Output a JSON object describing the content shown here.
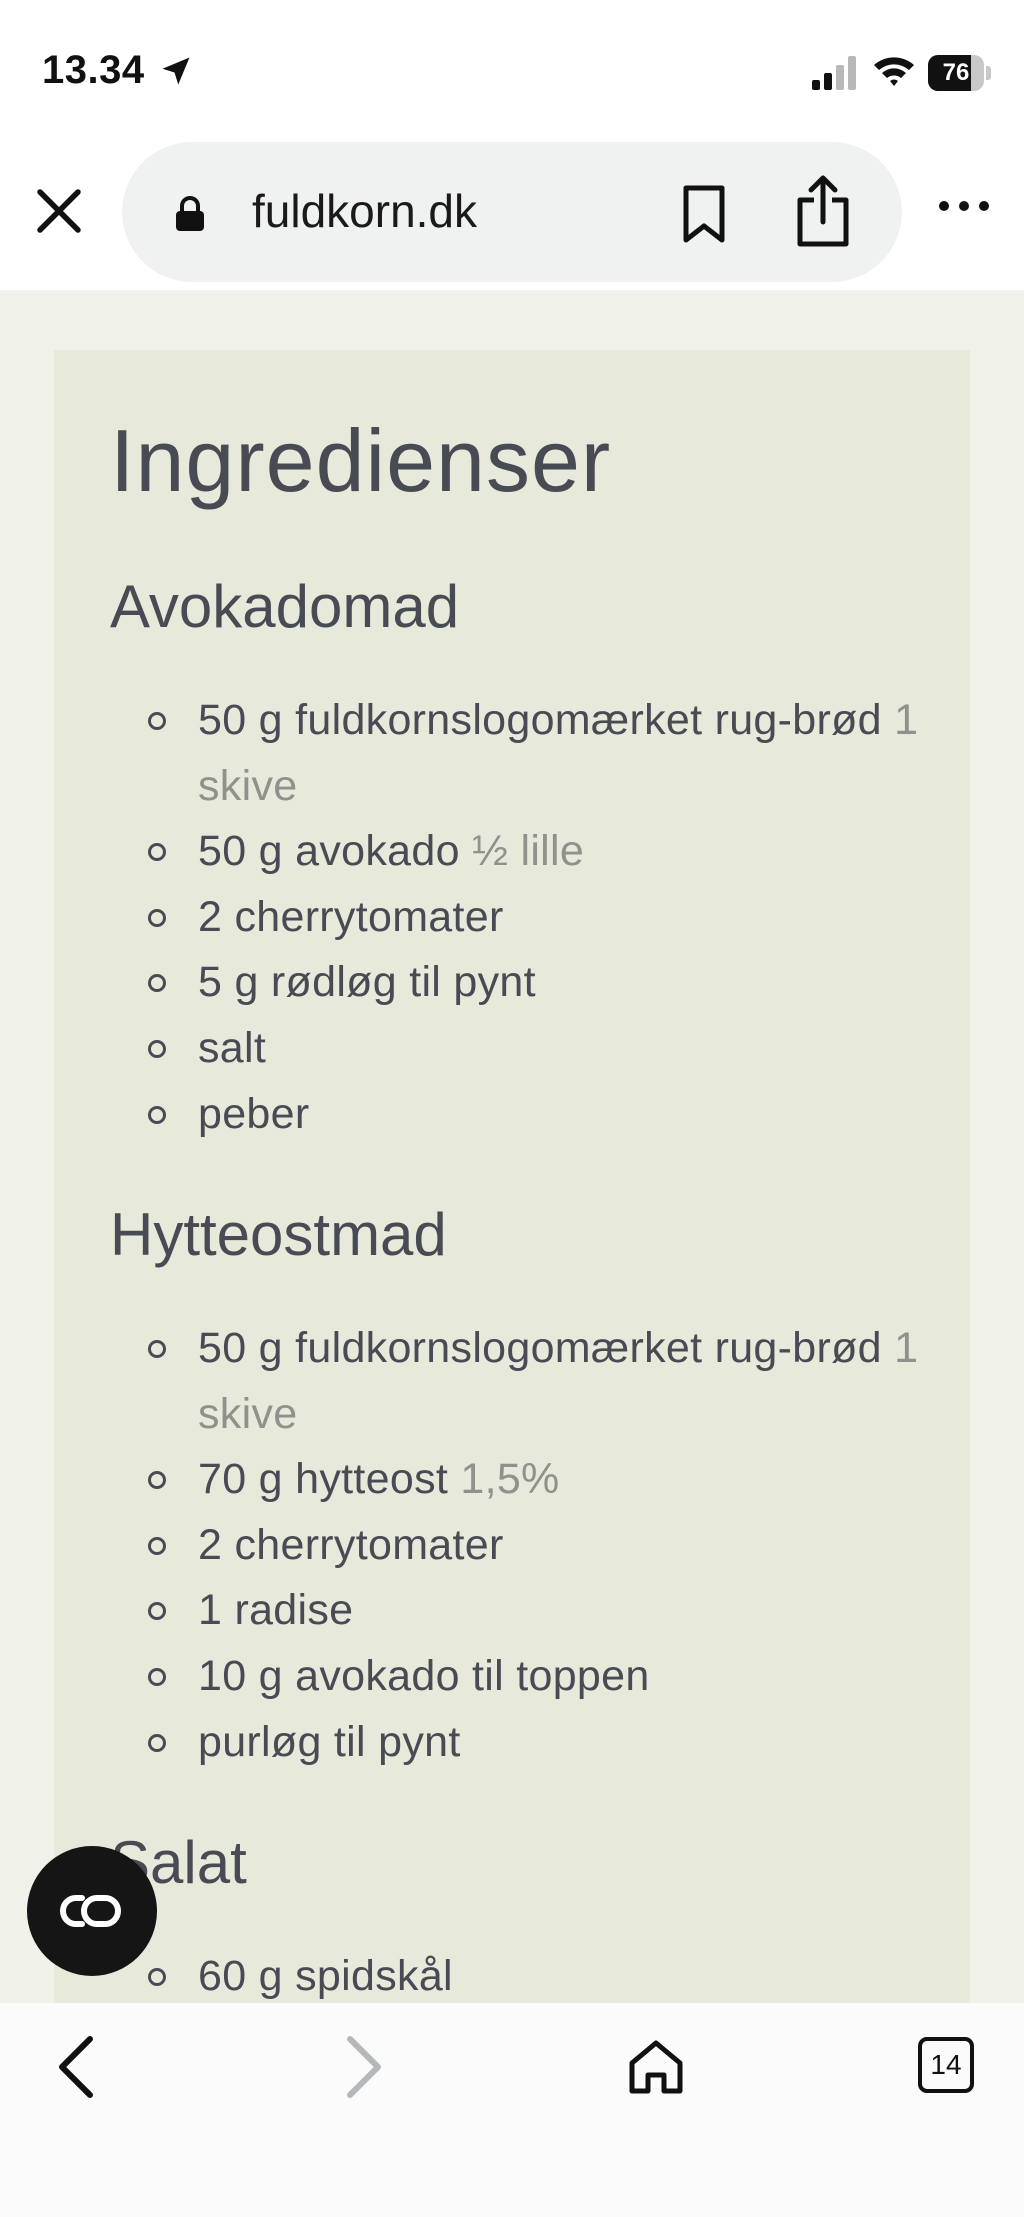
{
  "status": {
    "time": "13.34",
    "battery": "76",
    "battery_level": 0.76
  },
  "browser": {
    "url": "fuldkorn.dk",
    "tab_count": "14"
  },
  "recipe": {
    "title": "Ingredienser",
    "sections": [
      {
        "name": "Avokadomad",
        "items": [
          {
            "text": "50 g fuldkornslogomærket rug-brød",
            "note": "1 skive"
          },
          {
            "text": "50 g avokado",
            "note": "½ lille"
          },
          {
            "text": "2 cherrytomater",
            "note": ""
          },
          {
            "text": "5 g rødløg til pynt",
            "note": ""
          },
          {
            "text": "salt",
            "note": ""
          },
          {
            "text": "peber",
            "note": ""
          }
        ]
      },
      {
        "name": "Hytteostmad",
        "items": [
          {
            "text": "50 g fuldkornslogomærket rug-brød",
            "note": "1 skive"
          },
          {
            "text": "70 g hytteost",
            "note": "1,5%"
          },
          {
            "text": "2 cherrytomater",
            "note": ""
          },
          {
            "text": "1 radise",
            "note": ""
          },
          {
            "text": "10 g avokado til toppen",
            "note": ""
          },
          {
            "text": "purløg til pynt",
            "note": ""
          }
        ]
      },
      {
        "name": "Salat",
        "items": [
          {
            "text": "60 g spidskål",
            "note": ""
          }
        ]
      }
    ]
  },
  "icons": {
    "location": "location-arrow-icon",
    "signal": "cellular-signal-icon",
    "wifi": "wifi-icon",
    "close": "close-icon",
    "lock": "lock-icon",
    "bookmark": "bookmark-icon",
    "share": "share-icon",
    "more": "more-icon",
    "reader": "reader-mode-icon",
    "back": "chevron-left-icon",
    "forward": "chevron-right-icon",
    "home": "home-icon"
  },
  "colors": {
    "page_bg": "#f0f2ea",
    "card_bg": "#e7e9db",
    "text": "#494b54",
    "muted": "#8f918c"
  }
}
